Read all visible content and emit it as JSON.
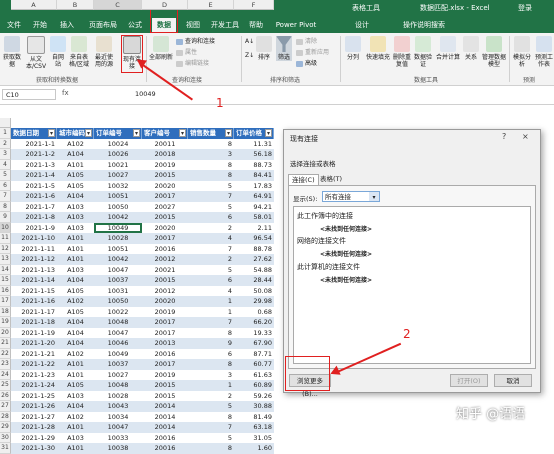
{
  "window": {
    "title": "数据匹配.xlsx - Excel",
    "context_group": "表格工具",
    "login": "登录",
    "tabs": [
      "文件",
      "开始",
      "插入",
      "页面布局",
      "公式",
      "数据",
      "视图",
      "开发工具",
      "帮助",
      "Power Pivot",
      "设计",
      "操作说明搜索"
    ],
    "active_tab": "数据"
  },
  "ribbon": {
    "get_data": "获取数据",
    "from_text": "从文本/CSV",
    "from_web": "自网站",
    "from_table": "来自表格/区域",
    "recent": "最近使用的源",
    "existing": "现有连接",
    "refresh": "全部刷新",
    "queries_conn": "查询和连接",
    "properties": "属性",
    "edit_links": "编辑链接",
    "sort_asc": "A↓",
    "sort_desc": "Z↓",
    "sort": "排序",
    "filter": "筛选",
    "clear": "清除",
    "reapply": "重新应用",
    "advanced": "高级",
    "split": "分列",
    "flash": "快速填充",
    "remove_dup": "删除重复值",
    "validation": "数据验证",
    "consolidate": "合并计算",
    "relations": "关系",
    "manage_model": "管理数据模型",
    "whatif": "模拟分析",
    "forecast": "预测工作表",
    "group_get": "获取和转换数据",
    "group_query": "查询和连接",
    "group_sort": "排序和筛选",
    "group_tools": "数据工具",
    "group_forecast": "预测"
  },
  "formula_bar": {
    "name_box": "C10",
    "fx": "fx",
    "value": "10049"
  },
  "columns": [
    "A",
    "B",
    "C",
    "D",
    "E",
    "F"
  ],
  "row_numbers": [
    "1",
    "2",
    "3",
    "4",
    "5",
    "6",
    "7",
    "8",
    "9",
    "10",
    "11",
    "12",
    "13",
    "14",
    "15",
    "16",
    "17",
    "18",
    "19",
    "20",
    "21",
    "22",
    "23",
    "24",
    "25",
    "26",
    "27",
    "28",
    "29",
    "30",
    "31"
  ],
  "table": {
    "headers": [
      "数据日期",
      "城市编码",
      "订单编号",
      "客户编号",
      "销售数量",
      "订单价格"
    ],
    "rows": [
      [
        "2021-1-1",
        "A102",
        "10024",
        "20011",
        "8",
        "11.31"
      ],
      [
        "2021-1-2",
        "A104",
        "10026",
        "20018",
        "3",
        "56.18"
      ],
      [
        "2021-1-3",
        "A101",
        "10021",
        "20019",
        "8",
        "88.73"
      ],
      [
        "2021-1-4",
        "A105",
        "10027",
        "20015",
        "8",
        "84.41"
      ],
      [
        "2021-1-5",
        "A105",
        "10032",
        "20020",
        "5",
        "17.83"
      ],
      [
        "2021-1-6",
        "A104",
        "10051",
        "20017",
        "7",
        "64.91"
      ],
      [
        "2021-1-7",
        "A103",
        "10050",
        "20027",
        "5",
        "94.21"
      ],
      [
        "2021-1-8",
        "A103",
        "10042",
        "20015",
        "6",
        "58.01"
      ],
      [
        "2021-1-9",
        "A103",
        "10049",
        "20020",
        "2",
        "2.11"
      ],
      [
        "2021-1-10",
        "A101",
        "10028",
        "20017",
        "4",
        "96.54"
      ],
      [
        "2021-1-11",
        "A101",
        "10051",
        "20016",
        "7",
        "88.78"
      ],
      [
        "2021-1-12",
        "A101",
        "10042",
        "20012",
        "2",
        "27.62"
      ],
      [
        "2021-1-13",
        "A103",
        "10047",
        "20021",
        "5",
        "54.88"
      ],
      [
        "2021-1-14",
        "A104",
        "10037",
        "20015",
        "6",
        "28.44"
      ],
      [
        "2021-1-15",
        "A105",
        "10031",
        "20012",
        "4",
        "50.08"
      ],
      [
        "2021-1-16",
        "A102",
        "10050",
        "20020",
        "1",
        "29.98"
      ],
      [
        "2021-1-17",
        "A105",
        "10022",
        "20019",
        "1",
        "0.68"
      ],
      [
        "2021-1-18",
        "A104",
        "10048",
        "20017",
        "7",
        "66.20"
      ],
      [
        "2021-1-19",
        "A104",
        "10047",
        "20017",
        "8",
        "19.33"
      ],
      [
        "2021-1-20",
        "A104",
        "10046",
        "20013",
        "9",
        "67.90"
      ],
      [
        "2021-1-21",
        "A102",
        "10049",
        "20016",
        "6",
        "87.71"
      ],
      [
        "2021-1-22",
        "A101",
        "10037",
        "20017",
        "8",
        "60.77"
      ],
      [
        "2021-1-23",
        "A101",
        "10027",
        "20019",
        "3",
        "61.63"
      ],
      [
        "2021-1-24",
        "A105",
        "10048",
        "20015",
        "1",
        "60.89"
      ],
      [
        "2021-1-25",
        "A103",
        "10028",
        "20015",
        "2",
        "59.26"
      ],
      [
        "2021-1-26",
        "A104",
        "10043",
        "20014",
        "5",
        "30.88"
      ],
      [
        "2021-1-27",
        "A102",
        "10034",
        "20014",
        "8",
        "81.49"
      ],
      [
        "2021-1-28",
        "A101",
        "10047",
        "20014",
        "7",
        "63.18"
      ],
      [
        "2021-1-29",
        "A103",
        "10033",
        "20016",
        "5",
        "31.05"
      ],
      [
        "2021-1-30",
        "A101",
        "10038",
        "20016",
        "8",
        "1.60"
      ]
    ]
  },
  "dialog": {
    "title": "现有连接",
    "help": "?",
    "close": "×",
    "subtitle": "选择连接或表格",
    "tab_connections": "连接(C)",
    "tab_tables": "表格(T)",
    "show_label": "显示(S):",
    "show_value": "所有连接",
    "section1": "此工作簿中的连接",
    "empty1": "<未找到任何连接>",
    "section2": "网络的连接文件",
    "empty2": "<未找到任何连接>",
    "section3": "此计算机的连接文件",
    "empty3": "<未找到任何连接>",
    "browse": "浏览更多(B)...",
    "open": "打开(O)",
    "cancel": "取消"
  },
  "annotations": {
    "one": "1",
    "two": "2"
  },
  "watermark": "知乎 @语语"
}
